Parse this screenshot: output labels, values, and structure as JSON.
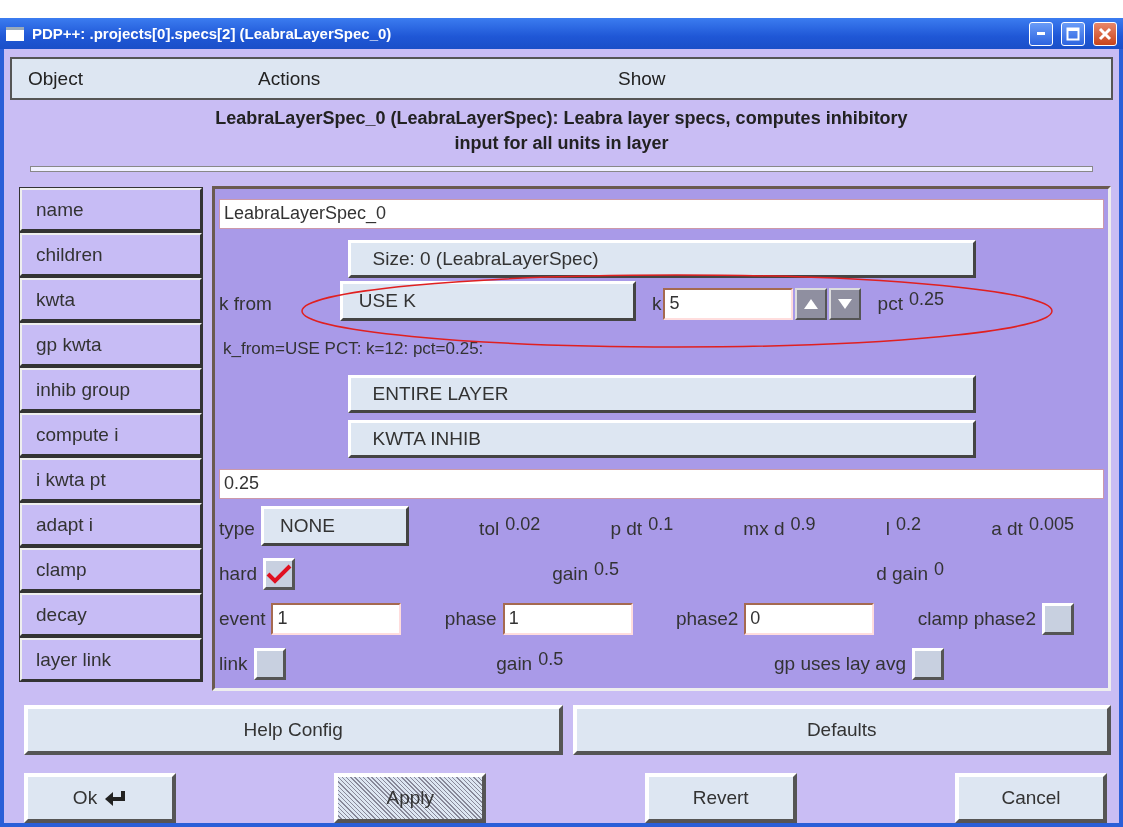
{
  "window": {
    "title": "PDP++:  .projects[0].specs[2] (LeabraLayerSpec_0)"
  },
  "menu": [
    "Object",
    "Actions",
    "Show"
  ],
  "description": "LeabraLayerSpec_0 (LeabraLayerSpec):  Leabra layer specs, computes inhibitory input for all units in layer",
  "rows": [
    {
      "label": "name",
      "kind": "text",
      "value": "LeabraLayerSpec_0"
    },
    {
      "label": "children",
      "kind": "button",
      "button": "Size: 0 (LeabraLayerSpec)"
    },
    {
      "label": "kwta",
      "kind": "fields",
      "items": [
        {
          "kind": "select",
          "label": "k from",
          "value": "USE K"
        },
        {
          "kind": "spin",
          "label": "k",
          "value": "5"
        },
        {
          "kind": "value",
          "label": "pct",
          "value": "0.25"
        }
      ]
    },
    {
      "label": "gp kwta",
      "kind": "note",
      "text": "k_from=USE PCT: k=12: pct=0.25:"
    },
    {
      "label": "inhib group",
      "kind": "button",
      "button": "ENTIRE LAYER"
    },
    {
      "label": "compute i",
      "kind": "button",
      "button": "KWTA INHIB"
    },
    {
      "label": "i kwta pt",
      "kind": "text",
      "value": "0.25"
    },
    {
      "label": "adapt i",
      "kind": "fields",
      "items": [
        {
          "kind": "select",
          "label": "type",
          "value": "NONE"
        },
        {
          "kind": "value",
          "label": "tol",
          "value": "0.02"
        },
        {
          "kind": "value",
          "label": "p dt",
          "value": "0.1"
        },
        {
          "kind": "value",
          "label": "mx d",
          "value": "0.9"
        },
        {
          "kind": "value",
          "label": "l",
          "value": "0.2"
        },
        {
          "kind": "value",
          "label": "a dt",
          "value": "0.005"
        }
      ]
    },
    {
      "label": "clamp",
      "kind": "fields",
      "items": [
        {
          "kind": "check",
          "label": "hard",
          "checked": true
        },
        {
          "kind": "value",
          "label": "gain",
          "value": "0.5"
        },
        {
          "kind": "value",
          "label": "d gain",
          "value": "0"
        }
      ]
    },
    {
      "label": "decay",
      "kind": "fields",
      "items": [
        {
          "kind": "input",
          "label": "event",
          "value": "1"
        },
        {
          "kind": "input",
          "label": "phase",
          "value": "1"
        },
        {
          "kind": "input",
          "label": "phase2",
          "value": "0"
        },
        {
          "kind": "check",
          "label": "clamp phase2",
          "checked": false
        }
      ]
    },
    {
      "label": "layer link",
      "kind": "fields",
      "items": [
        {
          "kind": "check",
          "label": "link",
          "checked": false
        },
        {
          "kind": "value",
          "label": "gain",
          "value": "0.5"
        },
        {
          "kind": "check",
          "label": "gp uses lay avg",
          "checked": false
        }
      ]
    }
  ],
  "wide_buttons": [
    "Help Config",
    "Defaults"
  ],
  "buttons": [
    {
      "label": "Ok",
      "kind": "enter",
      "disabled": false
    },
    {
      "label": "Apply",
      "kind": "plain",
      "disabled": true
    },
    {
      "label": "Revert",
      "kind": "plain",
      "disabled": false
    },
    {
      "label": "Cancel",
      "kind": "plain",
      "disabled": false
    }
  ]
}
